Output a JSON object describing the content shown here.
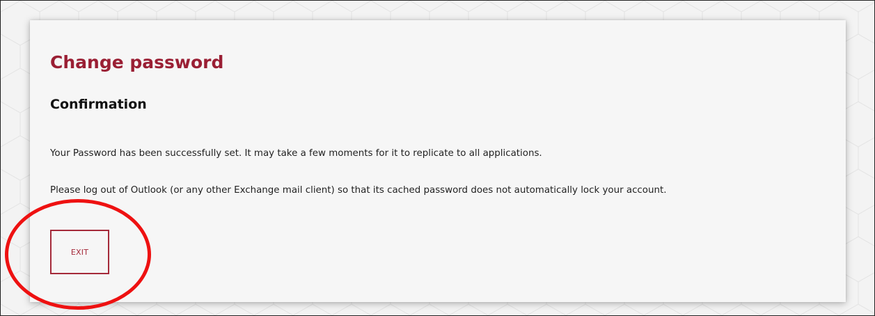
{
  "page": {
    "title": "Change password",
    "subtitle": "Confirmation",
    "messages": [
      "Your Password has been successfully set. It may take a few moments for it to replicate to all applications.",
      "Please log out of Outlook (or any other Exchange mail client) so that its cached password does not automatically lock your account."
    ],
    "exit_button_label": "EXIT"
  },
  "colors": {
    "title": "#9a1f34",
    "button_border": "#a52a3a",
    "card_background": "#f6f6f6",
    "page_background": "#f3f3f3",
    "annotation": "#ee1111"
  },
  "annotation": {
    "shape": "circle",
    "target": "exit-button"
  }
}
